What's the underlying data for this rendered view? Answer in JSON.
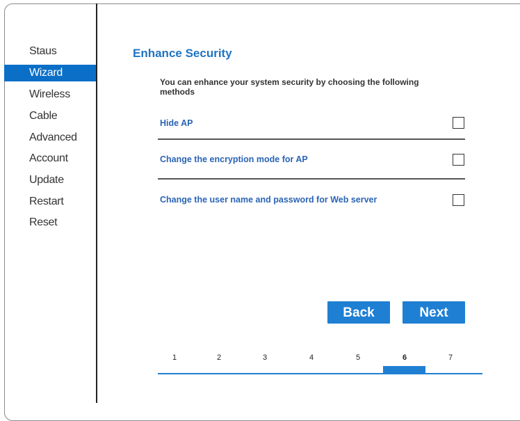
{
  "sidebar": {
    "items": [
      {
        "label": "Staus",
        "active": false
      },
      {
        "label": "Wizard",
        "active": true
      },
      {
        "label": "Wireless",
        "active": false
      },
      {
        "label": "Cable",
        "active": false
      },
      {
        "label": "Advanced",
        "active": false
      },
      {
        "label": "Account",
        "active": false
      },
      {
        "label": "Update",
        "active": false
      },
      {
        "label": "Restart",
        "active": false
      },
      {
        "label": "Reset",
        "active": false
      }
    ]
  },
  "main": {
    "title": "Enhance Security",
    "intro": "You can enhance your system security by choosing the following methods",
    "options": [
      {
        "label": "Hide AP",
        "checked": false
      },
      {
        "label": "Change the encryption mode for AP",
        "checked": false
      },
      {
        "label": "Change the user name and password for Web server",
        "checked": false
      }
    ]
  },
  "buttons": {
    "back_label": "Back",
    "next_label": "Next"
  },
  "steps": {
    "items": [
      "1",
      "2",
      "3",
      "4",
      "5",
      "6",
      "7"
    ],
    "current": "6"
  },
  "colors": {
    "accent": "#1f7fd3",
    "active_nav": "#0b6fc7",
    "title": "#1f74c3",
    "option_text": "#2a64b5"
  }
}
